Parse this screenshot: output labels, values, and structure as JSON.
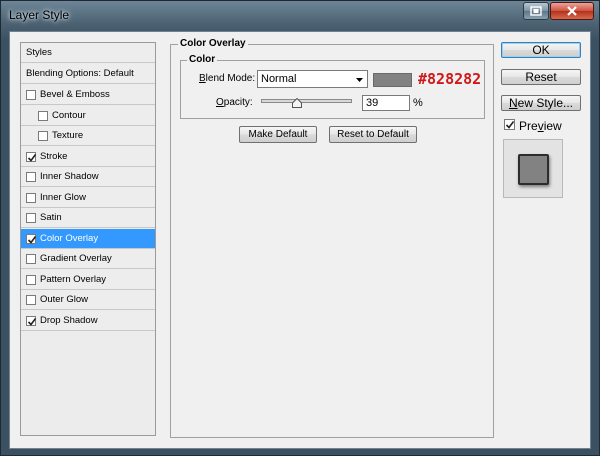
{
  "window": {
    "title": "Layer Style"
  },
  "styles_list": {
    "header": "Styles",
    "blending_options": "Blending Options: Default",
    "items": [
      {
        "label": "Bevel & Emboss",
        "checked": false,
        "indent": 0
      },
      {
        "label": "Contour",
        "checked": false,
        "indent": 1
      },
      {
        "label": "Texture",
        "checked": false,
        "indent": 1
      },
      {
        "label": "Stroke",
        "checked": true,
        "indent": 0
      },
      {
        "label": "Inner Shadow",
        "checked": false,
        "indent": 0
      },
      {
        "label": "Inner Glow",
        "checked": false,
        "indent": 0
      },
      {
        "label": "Satin",
        "checked": false,
        "indent": 0
      },
      {
        "label": "Color Overlay",
        "checked": true,
        "indent": 0,
        "selected": true
      },
      {
        "label": "Gradient Overlay",
        "checked": false,
        "indent": 0
      },
      {
        "label": "Pattern Overlay",
        "checked": false,
        "indent": 0
      },
      {
        "label": "Outer Glow",
        "checked": false,
        "indent": 0
      },
      {
        "label": "Drop Shadow",
        "checked": true,
        "indent": 0
      }
    ]
  },
  "panel": {
    "title": "Color Overlay",
    "group_title": "Color",
    "blend_mode_label_pre": "",
    "blend_mode_label_u": "B",
    "blend_mode_label_post": "lend Mode:",
    "blend_mode_value": "Normal",
    "overlay_color": "#828282",
    "overlay_color_note": "#828282",
    "opacity_label_u": "O",
    "opacity_label_post": "pacity:",
    "opacity_value": "39",
    "opacity_percent": 39,
    "opacity_unit": "%",
    "make_default": "Make Default",
    "reset_default": "Reset to Default"
  },
  "actions": {
    "ok": "OK",
    "reset": "Reset",
    "new_style_u": "N",
    "new_style_post": "ew Style...",
    "preview_u": "v",
    "preview_pre": "Pre",
    "preview_post": "iew",
    "preview_checked": true
  },
  "colors": {
    "accent": "#3399ff",
    "note_red": "#d01818"
  }
}
